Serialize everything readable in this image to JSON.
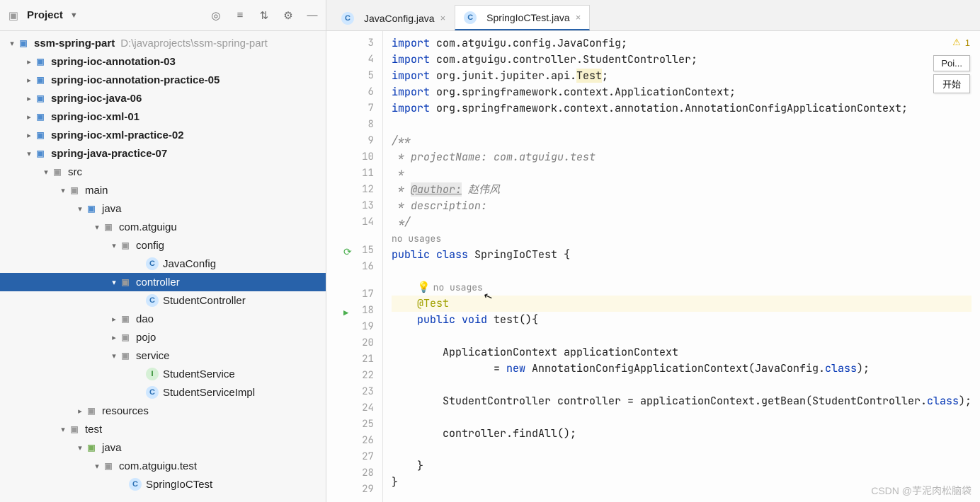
{
  "header": {
    "title": "Project",
    "icons": [
      "target",
      "expand",
      "collapse",
      "gear",
      "minimize"
    ]
  },
  "tree": {
    "root": {
      "label": "ssm-spring-part",
      "hint": "D:\\javaprojects\\ssm-spring-part"
    },
    "modules": [
      "spring-ioc-annotation-03",
      "spring-ioc-annotation-practice-05",
      "spring-ioc-java-06",
      "spring-ioc-xml-01",
      "spring-ioc-xml-practice-02"
    ],
    "expanded_module": "spring-java-practice-07",
    "src": "src",
    "main": "main",
    "main_java": "java",
    "main_pkg": "com.atguigu",
    "config_folder": "config",
    "config_class": "JavaConfig",
    "controller_folder": "controller",
    "controller_class": "StudentController",
    "dao_folder": "dao",
    "pojo_folder": "pojo",
    "service_folder": "service",
    "service_interface": "StudentService",
    "service_impl": "StudentServiceImpl",
    "resources": "resources",
    "test": "test",
    "test_java": "java",
    "test_pkg": "com.atguigu.test",
    "test_class": "SpringIoCTest"
  },
  "tabs": [
    {
      "label": "JavaConfig.java",
      "active": false
    },
    {
      "label": "SpringIoCTest.java",
      "active": true
    }
  ],
  "warning": {
    "count": "1"
  },
  "popup": {
    "line1": "Poi...",
    "line2": "开始"
  },
  "watermark": "CSDN @芋泥肉松脑袋",
  "code": {
    "lines": [
      {
        "n": 3,
        "text_html": "<span class='kw'>import</span> com.atguigu.config.JavaConfig;"
      },
      {
        "n": 4,
        "text_html": "<span class='kw'>import</span> com.atguigu.controller.StudentController;"
      },
      {
        "n": 5,
        "text_html": "<span class='kw'>import</span> org.junit.jupiter.api.<span class='hl-test'>Test</span>;"
      },
      {
        "n": 6,
        "text_html": "<span class='kw'>import</span> org.springframework.context.ApplicationContext;"
      },
      {
        "n": 7,
        "text_html": "<span class='kw'>import</span> org.springframework.context.annotation.AnnotationConfigApplicationContext;"
      },
      {
        "n": 8,
        "text_html": ""
      },
      {
        "n": 9,
        "text_html": "<span class='cm'>/**</span>"
      },
      {
        "n": 10,
        "text_html": "<span class='cm'> * projectName: com.atguigu.test</span>"
      },
      {
        "n": 11,
        "text_html": "<span class='cm'> *</span>"
      },
      {
        "n": 12,
        "text_html": "<span class='cm'> * <span class='tag'>@author:</span> 赵伟风</span>"
      },
      {
        "n": 13,
        "text_html": "<span class='cm'> * description:</span>"
      },
      {
        "n": 14,
        "text_html": "<span class='cm'> */</span>"
      },
      {
        "n": 0,
        "text_html": "<span class='inlay'>no usages</span>"
      },
      {
        "n": 15,
        "sync": true,
        "text_html": "<span class='kw'>public class</span> SpringIoCTest {"
      },
      {
        "n": 16,
        "text_html": ""
      },
      {
        "n": 0,
        "text_html": "    <span class='bulb'>💡</span><span class='inlay'>no usages</span>"
      },
      {
        "n": 17,
        "hl": true,
        "text_html": "    <span class='anno'>@Test</span>"
      },
      {
        "n": 18,
        "run": true,
        "text_html": "    <span class='kw'>public void</span> test(){"
      },
      {
        "n": 19,
        "text_html": ""
      },
      {
        "n": 20,
        "text_html": "        ApplicationContext applicationContext"
      },
      {
        "n": 21,
        "text_html": "                = <span class='kw'>new</span> AnnotationConfigApplicationContext(JavaConfig.<span class='kw'>class</span>);"
      },
      {
        "n": 22,
        "text_html": ""
      },
      {
        "n": 23,
        "text_html": "        StudentController controller = applicationContext.getBean(StudentController.<span class='kw'>class</span>);"
      },
      {
        "n": 24,
        "text_html": ""
      },
      {
        "n": 25,
        "text_html": "        controller.findAll();"
      },
      {
        "n": 26,
        "text_html": ""
      },
      {
        "n": 27,
        "text_html": "    }"
      },
      {
        "n": 28,
        "text_html": "}"
      },
      {
        "n": 29,
        "text_html": ""
      }
    ]
  }
}
